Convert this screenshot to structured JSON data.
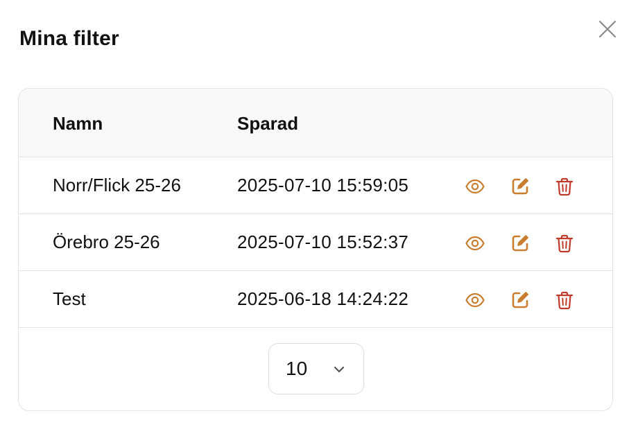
{
  "dialog": {
    "title": "Mina filter"
  },
  "table": {
    "columns": {
      "name": "Namn",
      "saved": "Sparad"
    },
    "rows": [
      {
        "name": "Norr/Flick 25-26",
        "saved": "2025-07-10 15:59:05"
      },
      {
        "name": "Örebro 25-26",
        "saved": "2025-07-10 15:52:37"
      },
      {
        "name": "Test",
        "saved": "2025-06-18 14:24:22"
      }
    ],
    "row_actions": [
      "eye-icon",
      "edit-icon",
      "trash-icon"
    ]
  },
  "pagination": {
    "page_size": "10"
  },
  "colors": {
    "action_orange": "#c97d2e",
    "delete_red": "#c0392b",
    "border": "#e3e3e3",
    "header_bg": "#f9f9f9",
    "close_gray": "#8a8a8a"
  }
}
